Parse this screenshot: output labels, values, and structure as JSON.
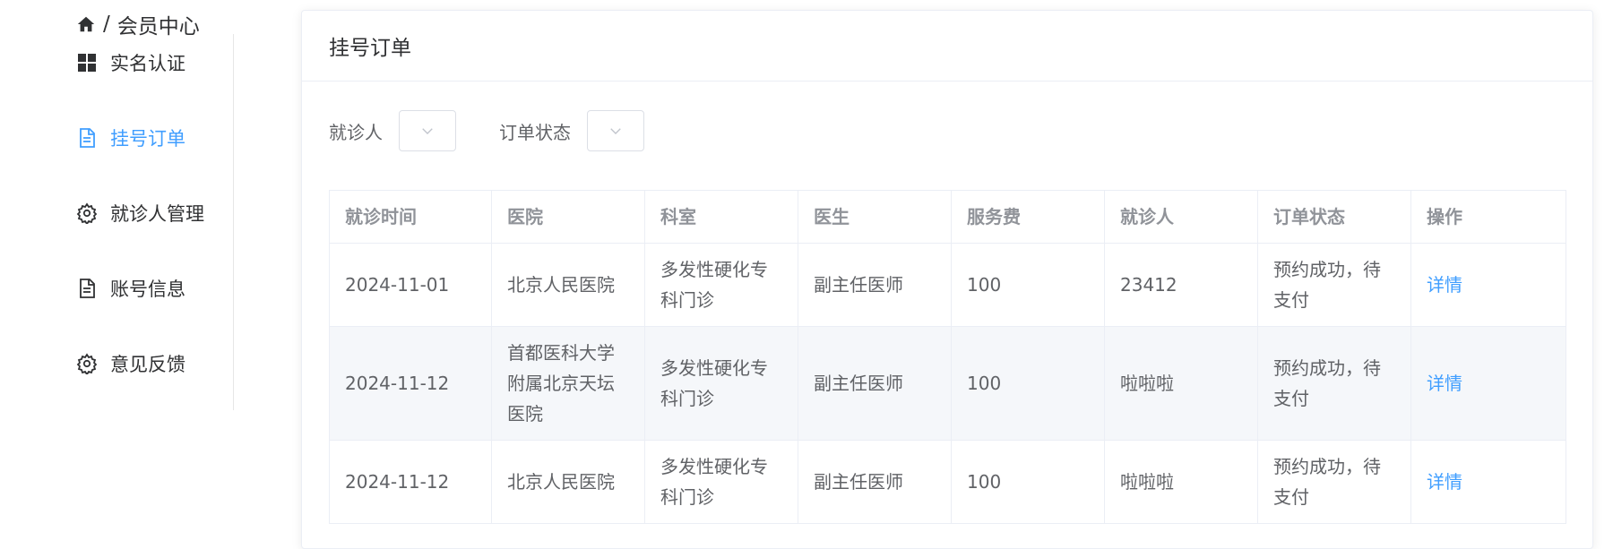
{
  "breadcrumb": {
    "separator": "/",
    "current": "会员中心"
  },
  "sidebar": {
    "items": [
      {
        "label": "实名认证",
        "icon": "grid-icon"
      },
      {
        "label": "挂号订单",
        "icon": "document-icon",
        "active": true
      },
      {
        "label": "就诊人管理",
        "icon": "gear-icon"
      },
      {
        "label": "账号信息",
        "icon": "file-text-icon"
      },
      {
        "label": "意见反馈",
        "icon": "gear-icon"
      }
    ]
  },
  "card": {
    "title": "挂号订单"
  },
  "filters": {
    "patient_label": "就诊人",
    "status_label": "订单状态"
  },
  "table": {
    "headers": [
      "就诊时间",
      "医院",
      "科室",
      "医生",
      "服务费",
      "就诊人",
      "订单状态",
      "操作"
    ],
    "rows": [
      {
        "date": "2024-11-01",
        "hospital": "北京人民医院",
        "department": "多发性硬化专科门诊",
        "doctor": "副主任医师",
        "fee": "100",
        "patient": "23412",
        "status": "预约成功，待支付",
        "action": "详情"
      },
      {
        "date": "2024-11-12",
        "hospital": "首都医科大学附属北京天坛医院",
        "department": "多发性硬化专科门诊",
        "doctor": "副主任医师",
        "fee": "100",
        "patient": "啦啦啦",
        "status": "预约成功，待支付",
        "action": "详情"
      },
      {
        "date": "2024-11-12",
        "hospital": "北京人民医院",
        "department": "多发性硬化专科门诊",
        "doctor": "副主任医师",
        "fee": "100",
        "patient": "啦啦啦",
        "status": "预约成功，待支付",
        "action": "详情"
      }
    ]
  },
  "colors": {
    "accent": "#409eff",
    "border": "#ebeef5",
    "stripe": "#f5f7fa"
  }
}
